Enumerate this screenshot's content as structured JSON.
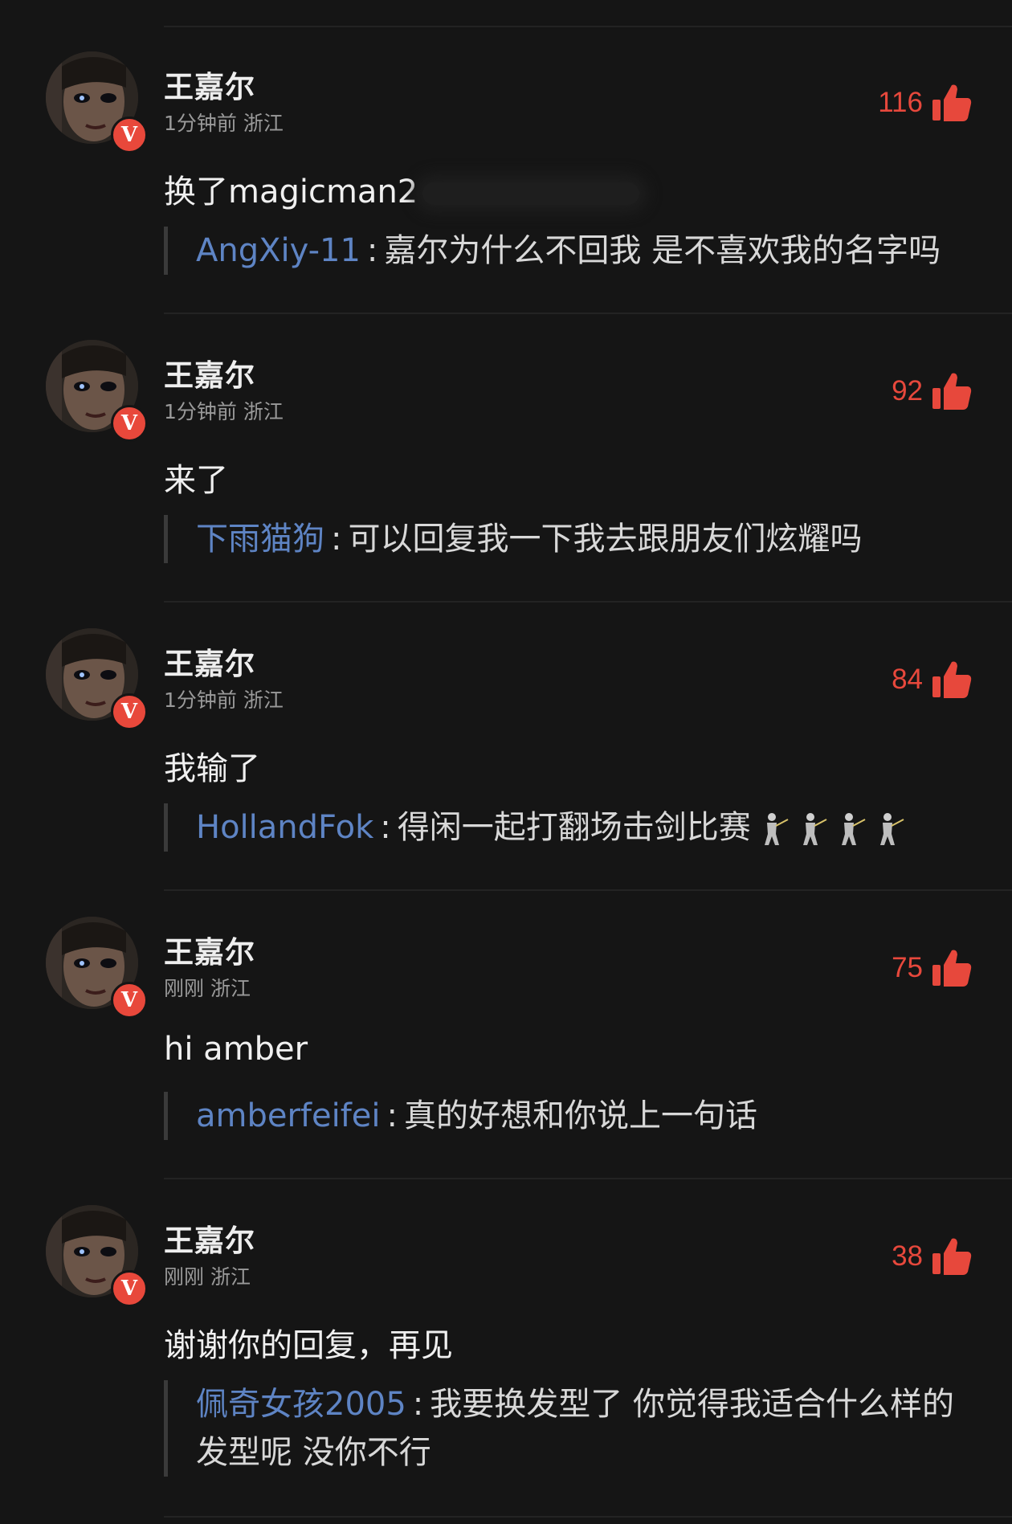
{
  "comments": [
    {
      "username": "王嘉尔",
      "meta": "1分钟前 浙江",
      "likes": "116",
      "content": "换了magicman2",
      "content_has_blurred_tail": true,
      "reply_user": "AngXiy-11",
      "reply_sep": ":",
      "reply_text": "嘉尔为什么不回我 是不喜欢我的名字吗"
    },
    {
      "username": "王嘉尔",
      "meta": "1分钟前 浙江",
      "likes": "92",
      "content": "来了",
      "reply_user": "下雨猫狗",
      "reply_sep": ":",
      "reply_text": "可以回复我一下我去跟朋友们炫耀吗"
    },
    {
      "username": "王嘉尔",
      "meta": "1分钟前 浙江",
      "likes": "84",
      "content": "我输了",
      "reply_user": "HollandFok",
      "reply_sep": ":",
      "reply_text": "得闲一起打翻场击剑比赛",
      "reply_emoji": [
        "fencer-emoji",
        "fencer-emoji",
        "fencer-emoji",
        "fencer-emoji"
      ]
    },
    {
      "username": "王嘉尔",
      "meta": "刚刚 浙江",
      "likes": "75",
      "content": "hi amber",
      "reply_user": "amberfeifei",
      "reply_sep": ":",
      "reply_text": "真的好想和你说上一句话"
    },
    {
      "username": "王嘉尔",
      "meta": "刚刚 浙江",
      "likes": "38",
      "content": "谢谢你的回复，再见",
      "reply_user": "佩奇女孩2005",
      "reply_sep": ":",
      "reply_text": "我要换发型了 你觉得我适合什么样的发型呢 没你不行"
    }
  ],
  "badge": {
    "label": "V",
    "color": "#e8483b"
  },
  "colors": {
    "background": "#151515",
    "like_accent": "#e7483c",
    "reply_user": "#5e84c4",
    "meta": "#9a9a9a"
  },
  "icons": {
    "like": "thumbs-up-icon",
    "avatar": "user-avatar",
    "verify": "verified-badge"
  }
}
